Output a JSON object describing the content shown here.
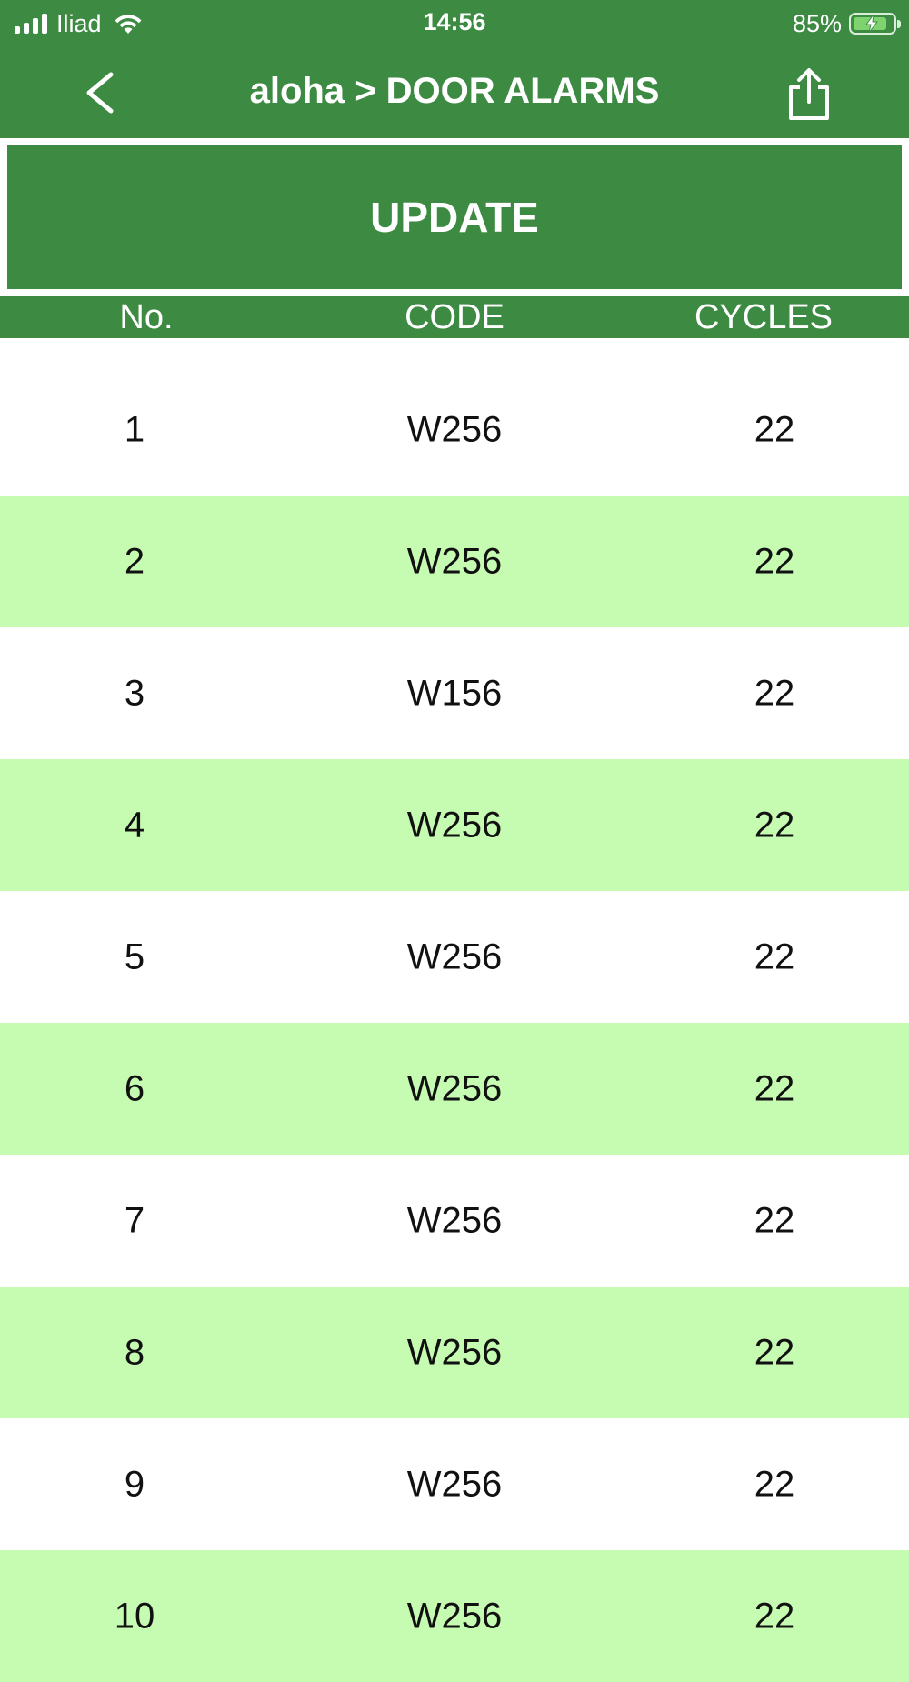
{
  "status_bar": {
    "carrier": "Iliad",
    "time": "14:56",
    "battery_percent": "85%",
    "battery_level": 0.85,
    "charging": true
  },
  "nav": {
    "title": "aloha > DOOR ALARMS",
    "back_icon": "chevron-left-icon",
    "share_icon": "share-icon"
  },
  "update_button": {
    "label": "UPDATE"
  },
  "table": {
    "headers": [
      "No.",
      "CODE",
      "CYCLES"
    ],
    "rows": [
      {
        "no": "1",
        "code": "W256",
        "cycles": "22"
      },
      {
        "no": "2",
        "code": "W256",
        "cycles": "22"
      },
      {
        "no": "3",
        "code": "W156",
        "cycles": "22"
      },
      {
        "no": "4",
        "code": "W256",
        "cycles": "22"
      },
      {
        "no": "5",
        "code": "W256",
        "cycles": "22"
      },
      {
        "no": "6",
        "code": "W256",
        "cycles": "22"
      },
      {
        "no": "7",
        "code": "W256",
        "cycles": "22"
      },
      {
        "no": "8",
        "code": "W256",
        "cycles": "22"
      },
      {
        "no": "9",
        "code": "W256",
        "cycles": "22"
      },
      {
        "no": "10",
        "code": "W256",
        "cycles": "22"
      }
    ]
  },
  "colors": {
    "primary_green": "#3d8b43",
    "stripe_green": "#c6fbb2",
    "white": "#ffffff"
  }
}
